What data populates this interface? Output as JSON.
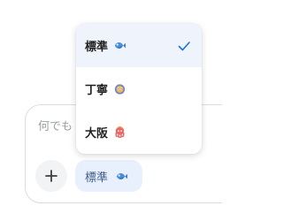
{
  "menu": {
    "items": [
      {
        "label": "標準",
        "icon": "fish-icon",
        "selected": true
      },
      {
        "label": "丁寧",
        "icon": "owl-icon",
        "selected": false
      },
      {
        "label": "大阪",
        "icon": "octopus-icon",
        "selected": false
      }
    ]
  },
  "composer": {
    "placeholder": "何でも"
  },
  "model_chip": {
    "label": "標準",
    "icon": "fish-icon"
  },
  "colors": {
    "accent": "#1a73e8",
    "selected_bg": "#eef3fc",
    "chip_bg": "#e8f0fe",
    "chip_text": "#3e5c8a"
  }
}
